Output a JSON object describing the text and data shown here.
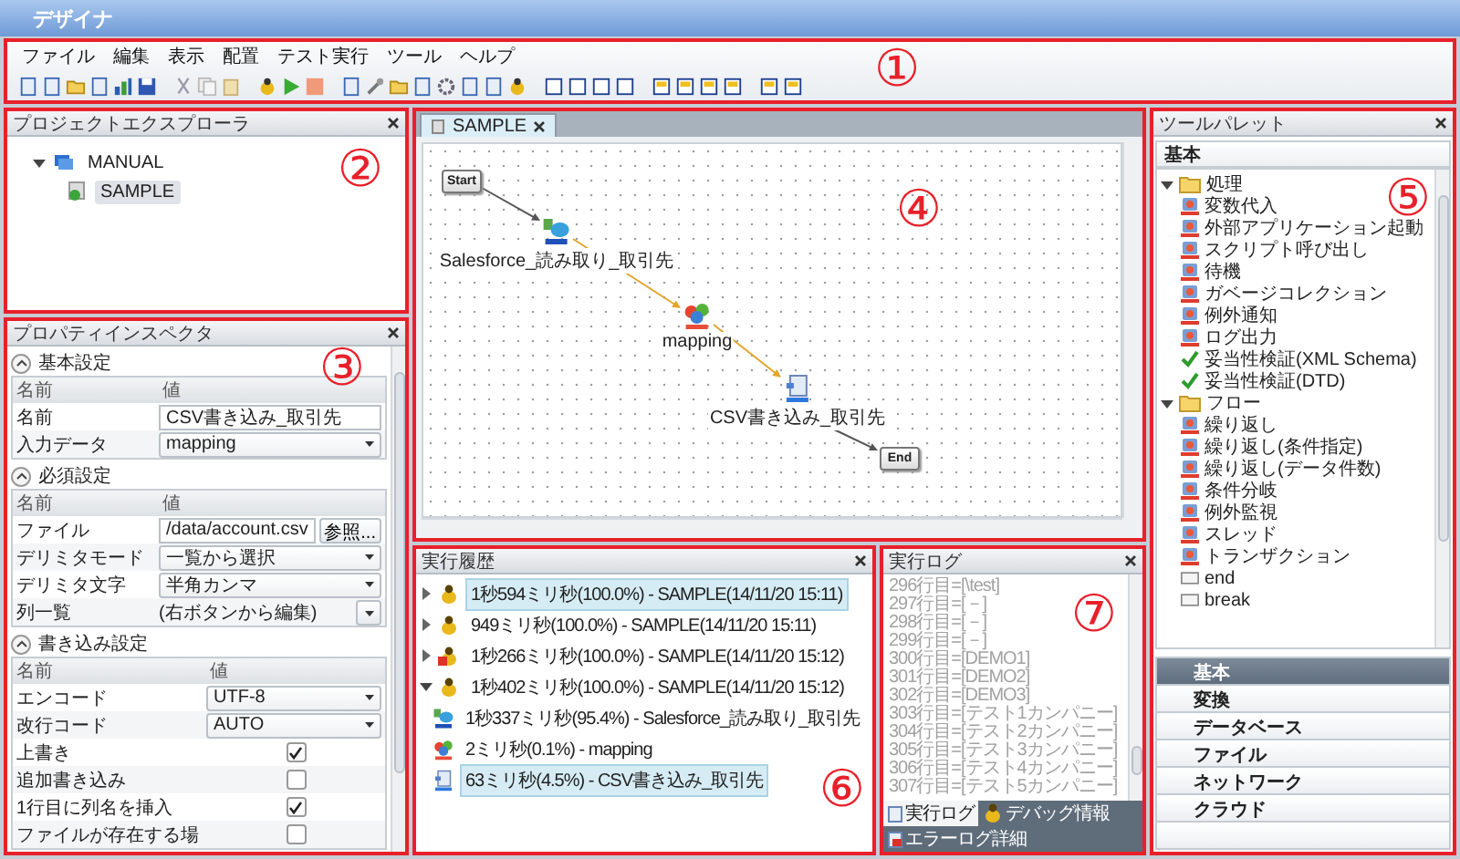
{
  "window": {
    "title": "デザイナ"
  },
  "header_callout": "①",
  "menu": [
    "ファイル",
    "編集",
    "表示",
    "配置",
    "テスト実行",
    "ツール",
    "ヘルプ"
  ],
  "project_explorer": {
    "title": "プロジェクトエクスプローラ",
    "callout": "②",
    "tree": [
      {
        "label": "MANUAL",
        "expanded": true,
        "selected": false,
        "children": [
          {
            "label": "SAMPLE",
            "selected": true
          }
        ]
      }
    ]
  },
  "property_inspector": {
    "title": "プロパティインスペクタ",
    "callout": "③",
    "sections": [
      {
        "title": "基本設定",
        "expanded": true,
        "columns": [
          "名前",
          "値"
        ],
        "rows": [
          {
            "kind": "text",
            "name": "名前",
            "value": "CSV書き込み_取引先"
          },
          {
            "kind": "select",
            "name": "入力データ",
            "value": "mapping"
          }
        ]
      },
      {
        "title": "必須設定",
        "expanded": true,
        "columns": [
          "名前",
          "値"
        ],
        "rows": [
          {
            "kind": "file",
            "name": "ファイル",
            "value": "/data/account.csv",
            "button": "参照..."
          },
          {
            "kind": "select",
            "name": "デリミタモード",
            "value": "一覧から選択"
          },
          {
            "kind": "select",
            "name": "デリミタ文字",
            "value": "半角カンマ"
          },
          {
            "kind": "list",
            "name": "列一覧",
            "value": "(右ボタンから編集)"
          }
        ]
      },
      {
        "title": "書き込み設定",
        "expanded": true,
        "columns": [
          "名前",
          "値"
        ],
        "rows": [
          {
            "kind": "select",
            "name": "エンコード",
            "value": "UTF-8"
          },
          {
            "kind": "select",
            "name": "改行コード",
            "value": "AUTO"
          },
          {
            "kind": "checkbox",
            "name": "上書き",
            "checked": true
          },
          {
            "kind": "checkbox",
            "name": "追加書き込み",
            "checked": false
          },
          {
            "kind": "checkbox",
            "name": "1行目に列名を挿入",
            "checked": true
          },
          {
            "kind": "checkbox",
            "name": "ファイルが存在する場",
            "checked": false
          }
        ]
      }
    ]
  },
  "editor": {
    "callout": "④",
    "tabs": [
      {
        "label": "SAMPLE",
        "selected": true
      }
    ],
    "nodes": [
      {
        "kind": "start",
        "label": "Start"
      },
      {
        "kind": "salesforce",
        "label": "Salesforce_読み取り_取引先"
      },
      {
        "kind": "mapping",
        "label": "mapping"
      },
      {
        "kind": "csv",
        "label": "CSV書き込み_取引先"
      },
      {
        "kind": "end",
        "label": "End"
      }
    ],
    "links": [
      {
        "kind": "control"
      },
      {
        "kind": "data"
      },
      {
        "kind": "data"
      },
      {
        "kind": "control"
      }
    ]
  },
  "history": {
    "title": "実行履歴",
    "callout": "⑥",
    "items": [
      {
        "label": "1秒594ミリ秒(100.0%) - SAMPLE(14/11/20 15:11)",
        "failed": false,
        "expanded": false,
        "selected": true
      },
      {
        "label": "949ミリ秒(100.0%) - SAMPLE(14/11/20 15:11)",
        "failed": false,
        "expanded": false,
        "selected": false
      },
      {
        "label": "1秒266ミリ秒(100.0%) - SAMPLE(14/11/20 15:12)",
        "failed": true,
        "expanded": false,
        "selected": false
      },
      {
        "label": "1秒402ミリ秒(100.0%) - SAMPLE(14/11/20 15:12)",
        "failed": false,
        "expanded": true,
        "selected": false,
        "children": [
          {
            "label": "1秒337ミリ秒(95.4%) - Salesforce_読み取り_取引先",
            "kind": "salesforce",
            "selected": false
          },
          {
            "label": "2ミリ秒(0.1%) - mapping",
            "kind": "mapping",
            "selected": false
          },
          {
            "label": "63ミリ秒(4.5%) - CSV書き込み_取引先",
            "kind": "csv",
            "selected": true
          }
        ]
      }
    ]
  },
  "log": {
    "title": "実行ログ",
    "callout": "⑦",
    "lines": [
      "296行目=[\\test]",
      "297行目=[－]",
      "298行目=[－]",
      "299行目=[－]",
      "300行目=[DEMO1]",
      "301行目=[DEMO2]",
      "302行目=[DEMO3]",
      "303行目=[テスト1カンパニー]",
      "304行目=[テスト2カンパニー]",
      "305行目=[テスト3カンパニー]",
      "306行目=[テスト4カンパニー]",
      "307行目=[テスト5カンパニー]"
    ],
    "tabs": [
      {
        "label": "実行ログ",
        "kind": "log",
        "selected": true
      },
      {
        "label": "デバッグ情報",
        "kind": "debug",
        "selected": false
      },
      {
        "label": "エラーログ詳細",
        "kind": "error",
        "selected": false
      }
    ]
  },
  "tool_palette": {
    "title": "ツールパレット",
    "callout": "⑤",
    "group": "基本",
    "tree": [
      {
        "label": "処理",
        "expanded": true,
        "children": [
          {
            "label": "変数代入",
            "kind": "task"
          },
          {
            "label": "外部アプリケーション起動",
            "kind": "task"
          },
          {
            "label": "スクリプト呼び出し",
            "kind": "task"
          },
          {
            "label": "待機",
            "kind": "task"
          },
          {
            "label": "ガベージコレクション",
            "kind": "task"
          },
          {
            "label": "例外通知",
            "kind": "task"
          },
          {
            "label": "ログ出力",
            "kind": "task"
          },
          {
            "label": "妥当性検証(XML Schema)",
            "kind": "check"
          },
          {
            "label": "妥当性検証(DTD)",
            "kind": "check"
          }
        ]
      },
      {
        "label": "フロー",
        "expanded": true,
        "children": [
          {
            "label": "繰り返し",
            "kind": "task"
          },
          {
            "label": "繰り返し(条件指定)",
            "kind": "task"
          },
          {
            "label": "繰り返し(データ件数)",
            "kind": "task"
          },
          {
            "label": "条件分岐",
            "kind": "task"
          },
          {
            "label": "例外監視",
            "kind": "task"
          },
          {
            "label": "スレッド",
            "kind": "task"
          },
          {
            "label": "トランザクション",
            "kind": "task"
          },
          {
            "label": "end",
            "kind": "tag"
          },
          {
            "label": "break",
            "kind": "tag"
          }
        ]
      }
    ],
    "categories": [
      {
        "label": "基本",
        "selected": true
      },
      {
        "label": "変換",
        "selected": false
      },
      {
        "label": "データベース",
        "selected": false
      },
      {
        "label": "ファイル",
        "selected": false
      },
      {
        "label": "ネットワーク",
        "selected": false
      },
      {
        "label": "クラウド",
        "selected": false
      }
    ]
  }
}
